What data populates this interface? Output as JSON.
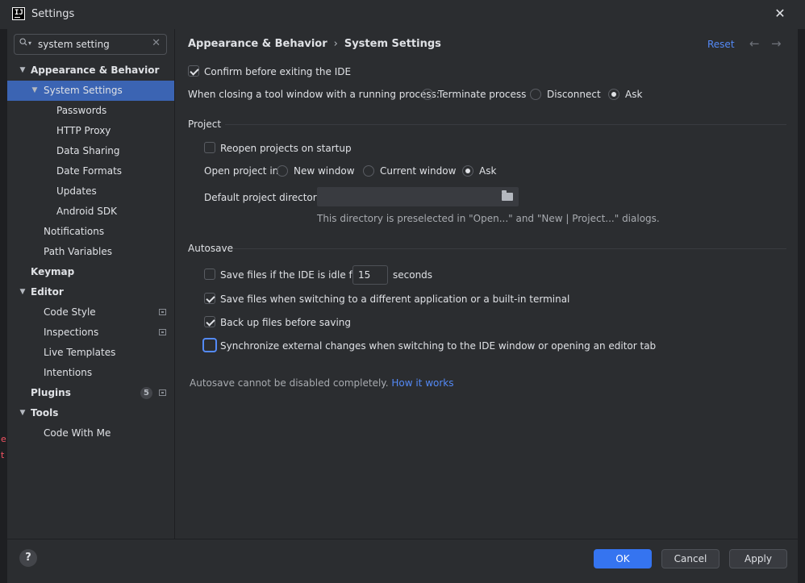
{
  "window": {
    "title": "Settings"
  },
  "search": {
    "value": "system setting"
  },
  "sidebar": {
    "items": [
      {
        "label": "Appearance & Behavior"
      },
      {
        "label": "System Settings"
      },
      {
        "label": "Passwords"
      },
      {
        "label": "HTTP Proxy"
      },
      {
        "label": "Data Sharing"
      },
      {
        "label": "Date Formats"
      },
      {
        "label": "Updates"
      },
      {
        "label": "Android SDK"
      },
      {
        "label": "Notifications"
      },
      {
        "label": "Path Variables"
      },
      {
        "label": "Keymap"
      },
      {
        "label": "Editor"
      },
      {
        "label": "Code Style"
      },
      {
        "label": "Inspections"
      },
      {
        "label": "Live Templates"
      },
      {
        "label": "Intentions"
      },
      {
        "label": "Plugins",
        "badge": "5"
      },
      {
        "label": "Tools"
      },
      {
        "label": "Code With Me"
      }
    ]
  },
  "header": {
    "breadcrumb_parent": "Appearance & Behavior",
    "breadcrumb_sep": "›",
    "breadcrumb_current": "System Settings",
    "reset": "Reset",
    "back": "←",
    "forward": "→"
  },
  "general": {
    "confirm_exit": "Confirm before exiting the IDE",
    "closing_label": "When closing a tool window with a running process:",
    "opt_terminate": "Terminate process",
    "opt_disconnect": "Disconnect",
    "opt_ask": "Ask"
  },
  "project": {
    "title": "Project",
    "reopen": "Reopen projects on startup",
    "open_in_label": "Open project in",
    "opt_new_window": "New window",
    "opt_current_window": "Current window",
    "opt_ask": "Ask",
    "default_dir_label": "Default project directory:",
    "default_dir_value": "",
    "default_dir_hint": "This directory is preselected in \"Open...\" and \"New | Project...\" dialogs."
  },
  "autosave": {
    "title": "Autosave",
    "idle_label": "Save files if the IDE is idle for",
    "idle_value": "15",
    "idle_unit": "seconds",
    "switching": "Save files when switching to a different application or a built-in terminal",
    "backup": "Back up files before saving",
    "sync": "Synchronize external changes when switching to the IDE window or opening an editor tab",
    "note": "Autosave cannot be disabled completely.",
    "note_link": "How it works"
  },
  "footer": {
    "help": "?",
    "ok": "OK",
    "cancel": "Cancel",
    "apply": "Apply"
  },
  "edge": {
    "mark1": "e",
    "mark2": "t"
  }
}
